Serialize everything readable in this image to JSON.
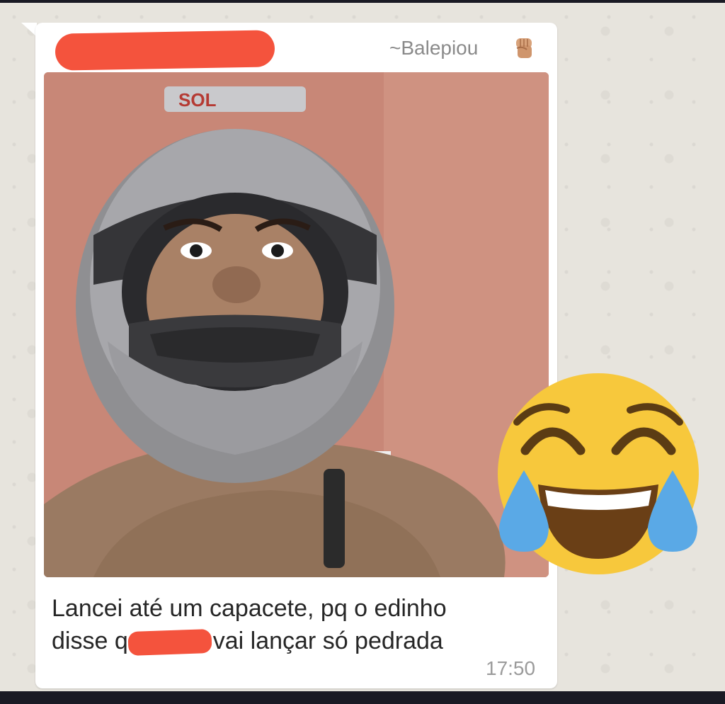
{
  "message": {
    "sender_display": "~Balepiou",
    "sender_emoji": "raised-fist-emoji",
    "caption_line_1": "Lancei até um capacete, pq o edinho",
    "caption_line_2_prefix": "disse q",
    "caption_line_2_suffix": "vai lançar só pedrada",
    "timestamp": "17:50",
    "photo": "selfie-with-motorcycle-helmet"
  },
  "overlay": {
    "emoji": "face-with-tears-of-joy-emoji"
  },
  "colors": {
    "bubble": "#ffffff",
    "redaction": "#f4533d",
    "sender": "#8a8a8a",
    "timestamp": "#9b9b9b",
    "wall": "#c68575",
    "emoji_face": "#f7c83c",
    "tears": "#5aa9e6"
  }
}
